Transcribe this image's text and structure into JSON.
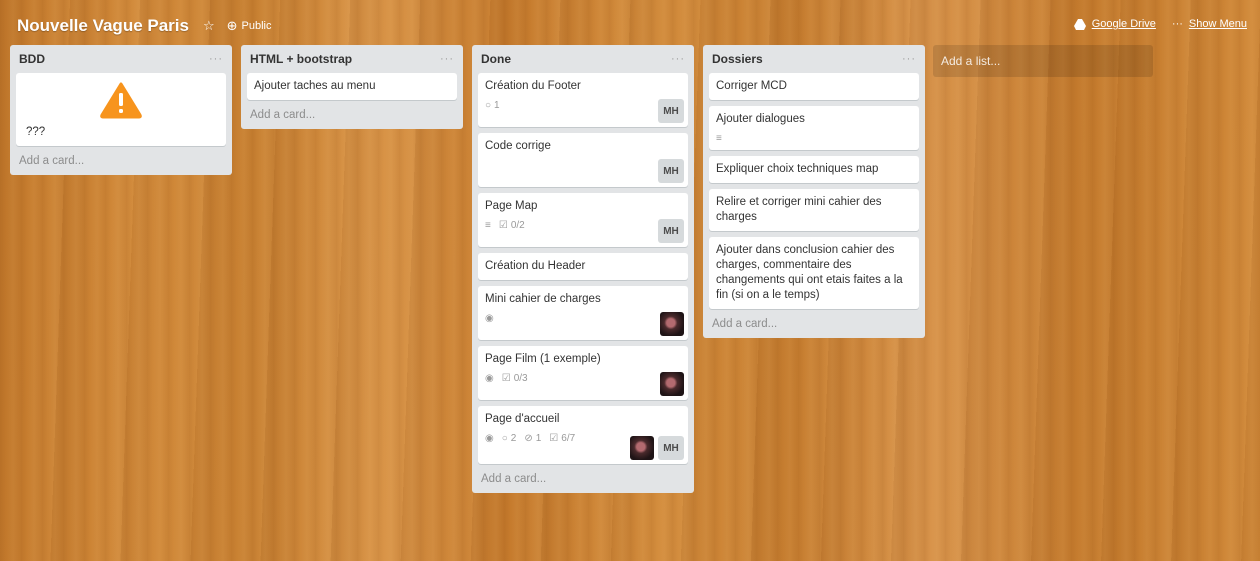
{
  "board": {
    "title": "Nouvelle Vague Paris",
    "visibility": "Public",
    "star_icon": "star-icon",
    "globe_icon": "globe-icon"
  },
  "header_right": {
    "google_drive": "Google Drive",
    "menu_dots": "···",
    "show_menu": "Show Menu"
  },
  "lists": [
    {
      "title": "BDD",
      "menu": "···",
      "cards": [
        {
          "title": "???",
          "warning_icon": "warning-icon"
        }
      ],
      "add_card": "Add a card..."
    },
    {
      "title": "HTML + bootstrap",
      "menu": "···",
      "cards": [
        {
          "title": "Ajouter taches au menu"
        }
      ],
      "add_card": "Add a card..."
    },
    {
      "title": "Done",
      "menu": "···",
      "cards": [
        {
          "title": "Création du Footer",
          "comments": "1",
          "member": "MH"
        },
        {
          "title": "Code corrige",
          "member": "MH"
        },
        {
          "title": "Page Map",
          "checklist": "0/2",
          "member": "MH"
        },
        {
          "title": "Création du Header"
        },
        {
          "title": "Mini cahier de charges"
        },
        {
          "title": "Page Film (1 exemple)",
          "checklist": "0/3"
        },
        {
          "title": "Page d'accueil",
          "comments": "2",
          "attachments": "1",
          "checklist": "6/7",
          "member": "MH"
        }
      ],
      "add_card": "Add a card..."
    },
    {
      "title": "Dossiers",
      "menu": "···",
      "cards": [
        {
          "title": "Corriger MCD"
        },
        {
          "title": "Ajouter dialogues"
        },
        {
          "title": "Expliquer choix techniques map"
        },
        {
          "title": "Relire et corriger mini cahier des charges"
        },
        {
          "title": "Ajouter dans conclusion cahier des charges, commentaire des changements qui ont etais faites a la fin (si on a le temps)"
        }
      ],
      "add_card": "Add a card..."
    }
  ],
  "add_list": "Add a list...",
  "colors": {
    "list_bg": "#e2e4e6",
    "card_bg": "#ffffff",
    "badge_bg": "#d6dadc",
    "warning": "#f7941d"
  }
}
